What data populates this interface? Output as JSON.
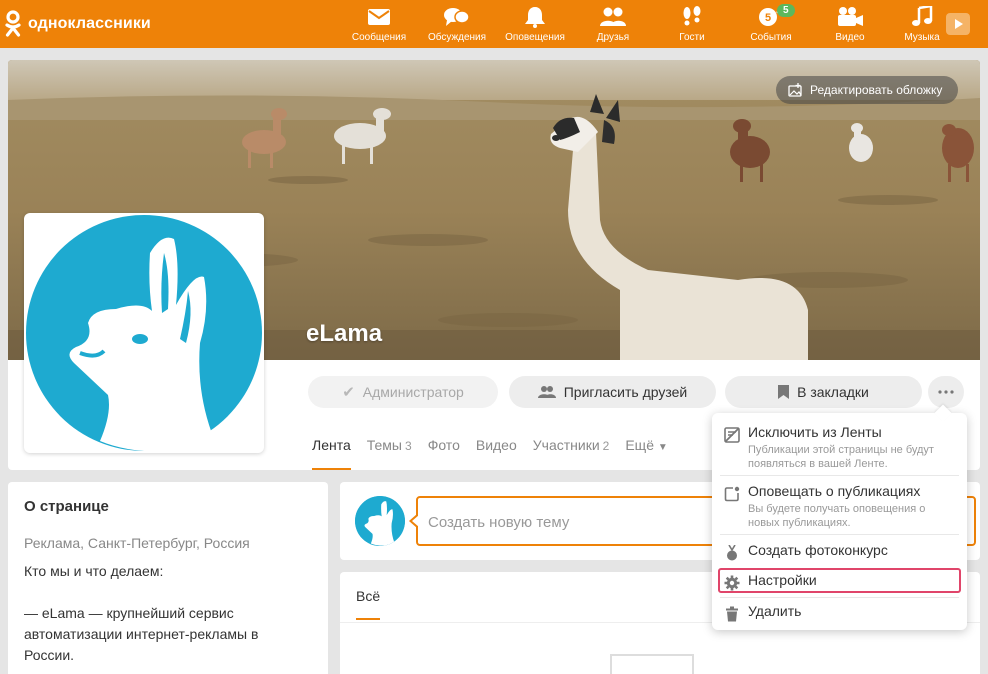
{
  "brand": {
    "name": "одноклассники",
    "accent": "#ee8208"
  },
  "topnav": [
    {
      "label": "Сообщения",
      "icon": "envelope-icon"
    },
    {
      "label": "Обсуждения",
      "icon": "speech-bubbles-icon"
    },
    {
      "label": "Оповещения",
      "icon": "bell-icon"
    },
    {
      "label": "Друзья",
      "icon": "friends-icon"
    },
    {
      "label": "Гости",
      "icon": "footprints-icon"
    },
    {
      "label": "События",
      "icon": "events-icon",
      "badge": "5"
    },
    {
      "label": "Видео",
      "icon": "video-camera-icon"
    },
    {
      "label": "Музыка",
      "icon": "music-note-icon"
    }
  ],
  "cover": {
    "edit_label": "Редактировать обложку"
  },
  "group": {
    "name": "eLama"
  },
  "actions": {
    "admin": "Администратор",
    "invite": "Пригласить друзей",
    "bookmark": "В закладки"
  },
  "tabs": [
    {
      "label": "Лента",
      "count": ""
    },
    {
      "label": "Темы",
      "count": "3"
    },
    {
      "label": "Фото",
      "count": ""
    },
    {
      "label": "Видео",
      "count": ""
    },
    {
      "label": "Участники",
      "count": "2"
    },
    {
      "label": "Ещё",
      "count": ""
    }
  ],
  "about": {
    "title": "О странице",
    "meta": "Реклама, Санкт-Петербург, Россия",
    "text": "Кто мы и что делаем:\n\n— eLama — крупнейший сервис автоматизации интернет-рекламы в России."
  },
  "composer": {
    "placeholder": "Создать новую тему"
  },
  "feed": {
    "tab": "Всё"
  },
  "menu": [
    {
      "title": "Исключить из Ленты",
      "desc": "Публикации этой страницы не будут\nпоявляться в вашей Ленте."
    },
    {
      "title": "Оповещать о публикациях",
      "desc": "Вы будете получать оповещения о\nновых публикациях."
    },
    {
      "title": "Создать фотоконкурс",
      "desc": ""
    },
    {
      "title": "Настройки",
      "desc": ""
    },
    {
      "title": "Удалить",
      "desc": ""
    }
  ]
}
